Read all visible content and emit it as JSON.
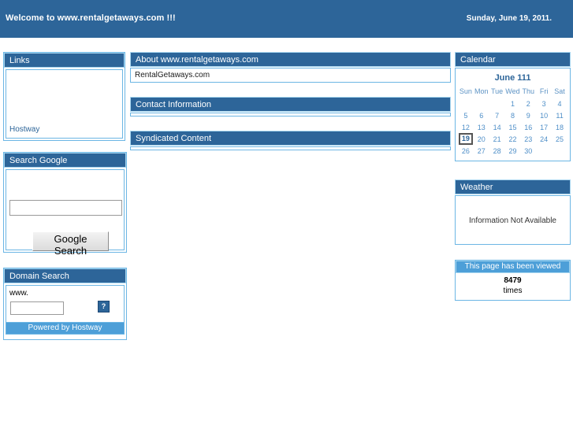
{
  "header": {
    "welcome": "Welcome to www.rentalgetaways.com !!!",
    "date": "Sunday, June 19, 2011.",
    "background_color": "#2d6599",
    "text_color": "#ffffff"
  },
  "theme": {
    "panel_header_color": "#2d6599",
    "panel_border_color": "#6cb6e4",
    "accent_light_blue": "#4d9fd8",
    "link_color": "#2d6599"
  },
  "sidebar": {
    "links_panel": {
      "title": "Links",
      "items": [
        {
          "label": "Hostway"
        }
      ]
    },
    "search_google_panel": {
      "title": "Search Google",
      "input_value": "",
      "input_placeholder": "",
      "button_label": "Google Search"
    },
    "domain_search_panel": {
      "title": "Domain Search",
      "www_label": "www.",
      "input_value": "",
      "input_placeholder": "",
      "help_button_label": "?",
      "footer_label": "Powered by Hostway"
    }
  },
  "main": {
    "about_panel": {
      "title": "About www.rentalgetaways.com",
      "body": "RentalGetaways.com"
    },
    "contact_panel": {
      "title": "Contact Information",
      "body": ""
    },
    "syndicated_panel": {
      "title": "Syndicated Content",
      "body": ""
    }
  },
  "right": {
    "calendar_panel": {
      "title": "Calendar",
      "month_label": "June 111",
      "day_headers": [
        "Sun",
        "Mon",
        "Tue",
        "Wed",
        "Thu",
        "Fri",
        "Sat"
      ],
      "weeks": [
        [
          "",
          "",
          "",
          "1",
          "2",
          "3",
          "4"
        ],
        [
          "5",
          "6",
          "7",
          "8",
          "9",
          "10",
          "11"
        ],
        [
          "12",
          "13",
          "14",
          "15",
          "16",
          "17",
          "18"
        ],
        [
          "19",
          "20",
          "21",
          "22",
          "23",
          "24",
          "25"
        ],
        [
          "26",
          "27",
          "28",
          "29",
          "30",
          "",
          ""
        ]
      ],
      "today": "19"
    },
    "weather_panel": {
      "title": "Weather",
      "message": "Information Not Available"
    },
    "counter_panel": {
      "title": "This page has been viewed",
      "count": "8479",
      "unit": "times"
    }
  }
}
